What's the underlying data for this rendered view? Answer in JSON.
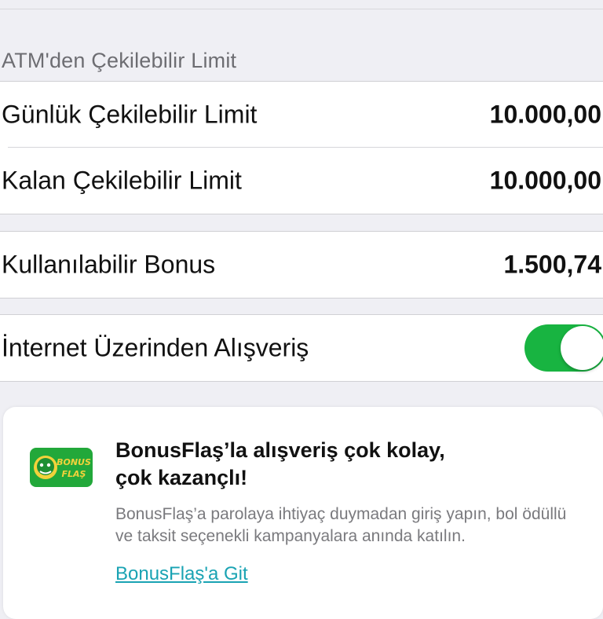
{
  "atm_section": {
    "header": "ATM'den Çekilebilir Limit",
    "rows": [
      {
        "label": "Günlük Çekilebilir Limit",
        "value": "10.000,00"
      },
      {
        "label": "Kalan Çekilebilir Limit",
        "value": "10.000,00"
      }
    ]
  },
  "bonus": {
    "label": "Kullanılabilir Bonus",
    "value": "1.500,74"
  },
  "internet_shopping": {
    "label": "İnternet Üzerinden Alışveriş",
    "enabled": true
  },
  "promo": {
    "logo_text_line1": "BONUS",
    "logo_text_line2": "FLAŞ",
    "title_line1": "BonusFlaş’la alışveriş çok kolay,",
    "title_line2": "çok kazançlı!",
    "description": "BonusFlaş’a parolaya ihtiyaç duymadan giriş yapın, bol ödüllü ve taksit seçenekli kampanyalara anında katılın.",
    "link": "BonusFlaş'a Git"
  },
  "colors": {
    "background": "#efeff4",
    "toggle_on": "#18b441",
    "link": "#1aa3b3",
    "logo_green": "#22a83a"
  }
}
